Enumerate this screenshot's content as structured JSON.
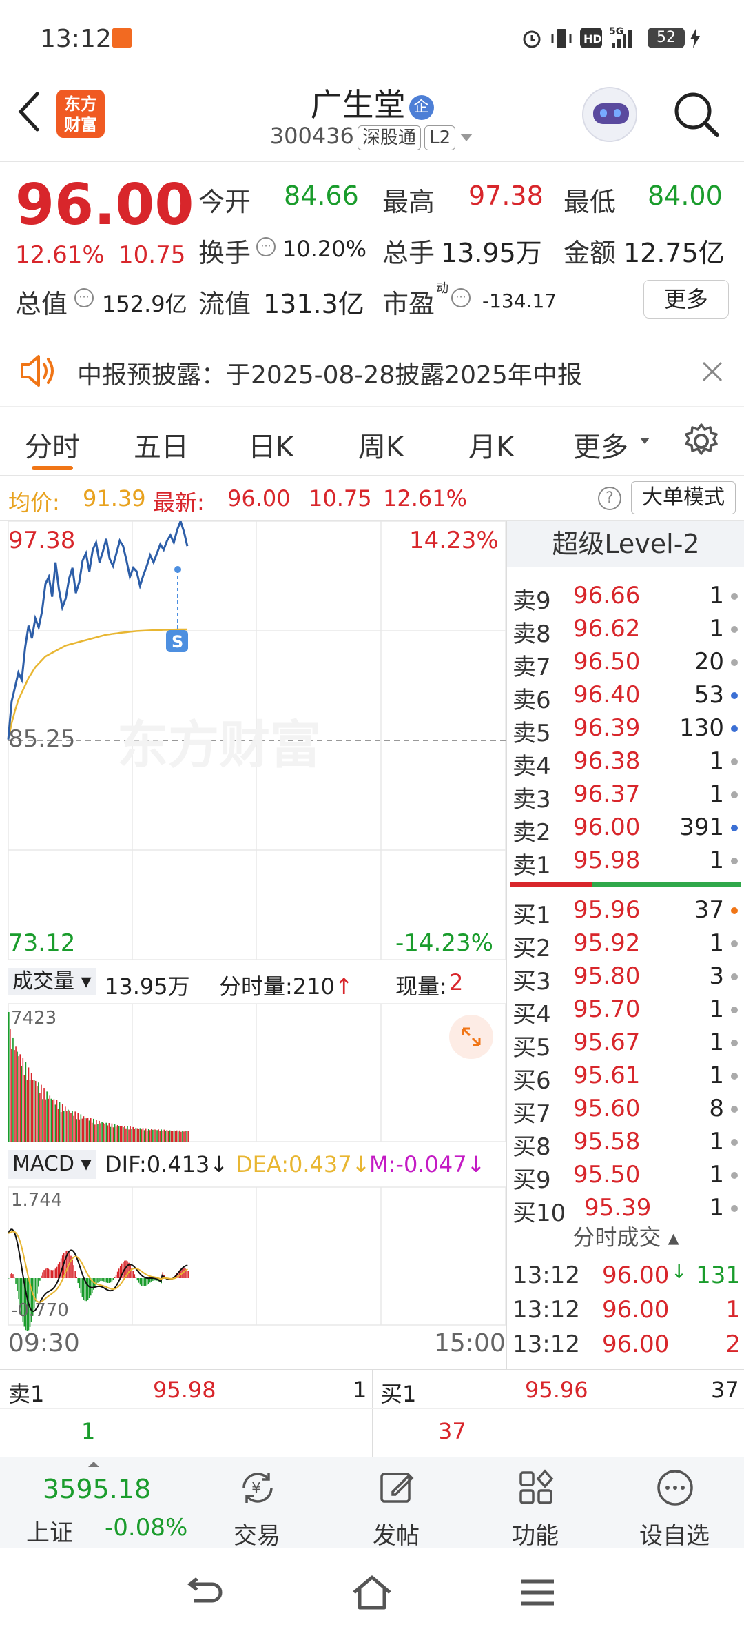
{
  "status_bar": {
    "time": "13:12",
    "battery": "52"
  },
  "header": {
    "logo_line1": "东方",
    "logo_line2": "财富",
    "stock_name": "广生堂",
    "stock_badge": "企",
    "stock_code": "300436",
    "exchange_chip": "深股通",
    "level_chip": "L2"
  },
  "quote": {
    "price": "96.00",
    "change_pct": "12.61%",
    "change_amt": "10.75",
    "open_label": "今开",
    "open": "84.66",
    "high_label": "最高",
    "high": "97.38",
    "low_label": "最低",
    "low": "84.00",
    "turnover_label": "换手",
    "turnover": "10.20%",
    "volume_label": "总手",
    "volume": "13.95万",
    "amount_label": "金额",
    "amount": "12.75亿",
    "mktcap_label": "总值",
    "mktcap": "152.9亿",
    "float_label": "流值",
    "float_cap": "131.3亿",
    "pe_label": "市盈",
    "pe_sup": "动",
    "pe": "-134.17",
    "more_button": "更多"
  },
  "notice": {
    "text": "中报预披露：于2025-08-28披露2025年中报"
  },
  "tabs": {
    "t1": "分时",
    "t2": "五日",
    "t3": "日K",
    "t4": "周K",
    "t5": "月K",
    "t6": "更多"
  },
  "avg_bar": {
    "avg_label": "均价:",
    "avg": "91.39",
    "latest_label": "最新:",
    "latest": "96.00",
    "chg": "10.75",
    "pct": "12.61%",
    "big_order": "大单模式"
  },
  "chart": {
    "top_price": "97.38",
    "top_pct": "14.23%",
    "mid_price": "85.25",
    "bottom_price": "73.12",
    "bottom_pct": "-14.23%",
    "watermark": "东方财富",
    "marker": "S",
    "vol_label": "成交量",
    "vol_total": "13.95万",
    "vol_tick_label": "分时量:210",
    "vol_now_label": "现量:",
    "vol_now": "2",
    "vol_max": "7423",
    "macd_label": "MACD",
    "dif": "DIF:0.413",
    "dea": "DEA:0.437",
    "m": "M:-0.047",
    "macd_top": "1.744",
    "macd_bottom": "-0.770",
    "time_start": "09:30",
    "time_end": "15:00"
  },
  "chart_data": {
    "type": "line",
    "title": "",
    "x": [
      "09:30",
      "15:00"
    ],
    "ylim": [
      73.12,
      97.38
    ],
    "prev_close": 85.25,
    "series": [],
    "price_values": [
      85.3,
      87.4,
      88.2,
      89.0,
      88.6,
      90.4,
      91.6,
      90.9,
      92.0,
      91.5,
      92.4,
      93.9,
      94.3,
      93.2,
      95.1,
      93.6,
      92.6,
      93.1,
      94.2,
      94.8,
      93.4,
      94.0,
      95.2,
      95.6,
      94.6,
      95.8,
      96.2,
      95.1,
      95.7,
      96.4,
      95.3,
      94.9,
      95.6,
      96.3,
      96.0,
      95.2,
      94.3,
      94.8,
      94.6,
      93.8,
      94.4,
      94.9,
      95.5,
      95.1,
      95.6,
      96.1,
      95.8,
      96.3,
      96.6,
      96.2,
      96.9,
      97.38,
      96.8,
      96.0
    ],
    "avg_values": [
      85.3,
      86.2,
      86.9,
      87.5,
      87.9,
      88.3,
      88.7,
      89.0,
      89.3,
      89.5,
      89.7,
      89.9,
      90.0,
      90.1,
      90.2,
      90.3,
      90.4,
      90.5,
      90.55,
      90.6,
      90.65,
      90.7,
      90.75,
      90.8,
      90.85,
      90.9,
      90.95,
      91.0,
      91.05,
      91.1,
      91.12,
      91.15,
      91.17,
      91.2,
      91.22,
      91.24,
      91.26,
      91.28,
      91.3,
      91.31,
      91.32,
      91.33,
      91.34,
      91.35,
      91.36,
      91.36,
      91.37,
      91.37,
      91.38,
      91.38,
      91.39,
      91.39,
      91.39,
      91.39
    ]
  },
  "orderbook": {
    "title": "超级Level-2",
    "asks": [
      {
        "label": "卖9",
        "price": "96.66",
        "qty": "1"
      },
      {
        "label": "卖8",
        "price": "96.62",
        "qty": "1"
      },
      {
        "label": "卖7",
        "price": "96.50",
        "qty": "20"
      },
      {
        "label": "卖6",
        "price": "96.40",
        "qty": "53"
      },
      {
        "label": "卖5",
        "price": "96.39",
        "qty": "130"
      },
      {
        "label": "卖4",
        "price": "96.38",
        "qty": "1"
      },
      {
        "label": "卖3",
        "price": "96.37",
        "qty": "1"
      },
      {
        "label": "卖2",
        "price": "96.00",
        "qty": "391"
      },
      {
        "label": "卖1",
        "price": "95.98",
        "qty": "1"
      }
    ],
    "bids": [
      {
        "label": "买1",
        "price": "95.96",
        "qty": "37"
      },
      {
        "label": "买2",
        "price": "95.92",
        "qty": "1"
      },
      {
        "label": "买3",
        "price": "95.80",
        "qty": "3"
      },
      {
        "label": "买4",
        "price": "95.70",
        "qty": "1"
      },
      {
        "label": "买5",
        "price": "95.67",
        "qty": "1"
      },
      {
        "label": "买6",
        "price": "95.61",
        "qty": "1"
      },
      {
        "label": "买7",
        "price": "95.60",
        "qty": "8"
      },
      {
        "label": "买8",
        "price": "95.58",
        "qty": "1"
      },
      {
        "label": "买9",
        "price": "95.50",
        "qty": "1"
      },
      {
        "label": "买10",
        "price": "95.39",
        "qty": "1"
      }
    ],
    "trades_title": "分时成交",
    "trades": [
      {
        "time": "13:12",
        "price": "96.00",
        "qty": "131"
      },
      {
        "time": "13:12",
        "price": "96.00",
        "qty": "1"
      },
      {
        "time": "13:12",
        "price": "96.00",
        "qty": "2"
      }
    ]
  },
  "bottom_quote": {
    "ask_label": "卖1",
    "ask_price": "95.98",
    "ask_qty": "1",
    "bid_label": "买1",
    "bid_price": "95.96",
    "bid_qty": "37",
    "ask_sub": "1",
    "bid_sub": "37"
  },
  "toolbar": {
    "index_value": "3595.18",
    "index_name": "上证",
    "index_change": "-0.08%",
    "trade": "交易",
    "post": "发帖",
    "functions": "功能",
    "watchlist": "设自选"
  },
  "colors": {
    "up": "#d8262b",
    "down": "#1a9c2c",
    "accent": "#f07516",
    "price_line": "#2d5ea8",
    "avg_line": "#e8b632"
  }
}
